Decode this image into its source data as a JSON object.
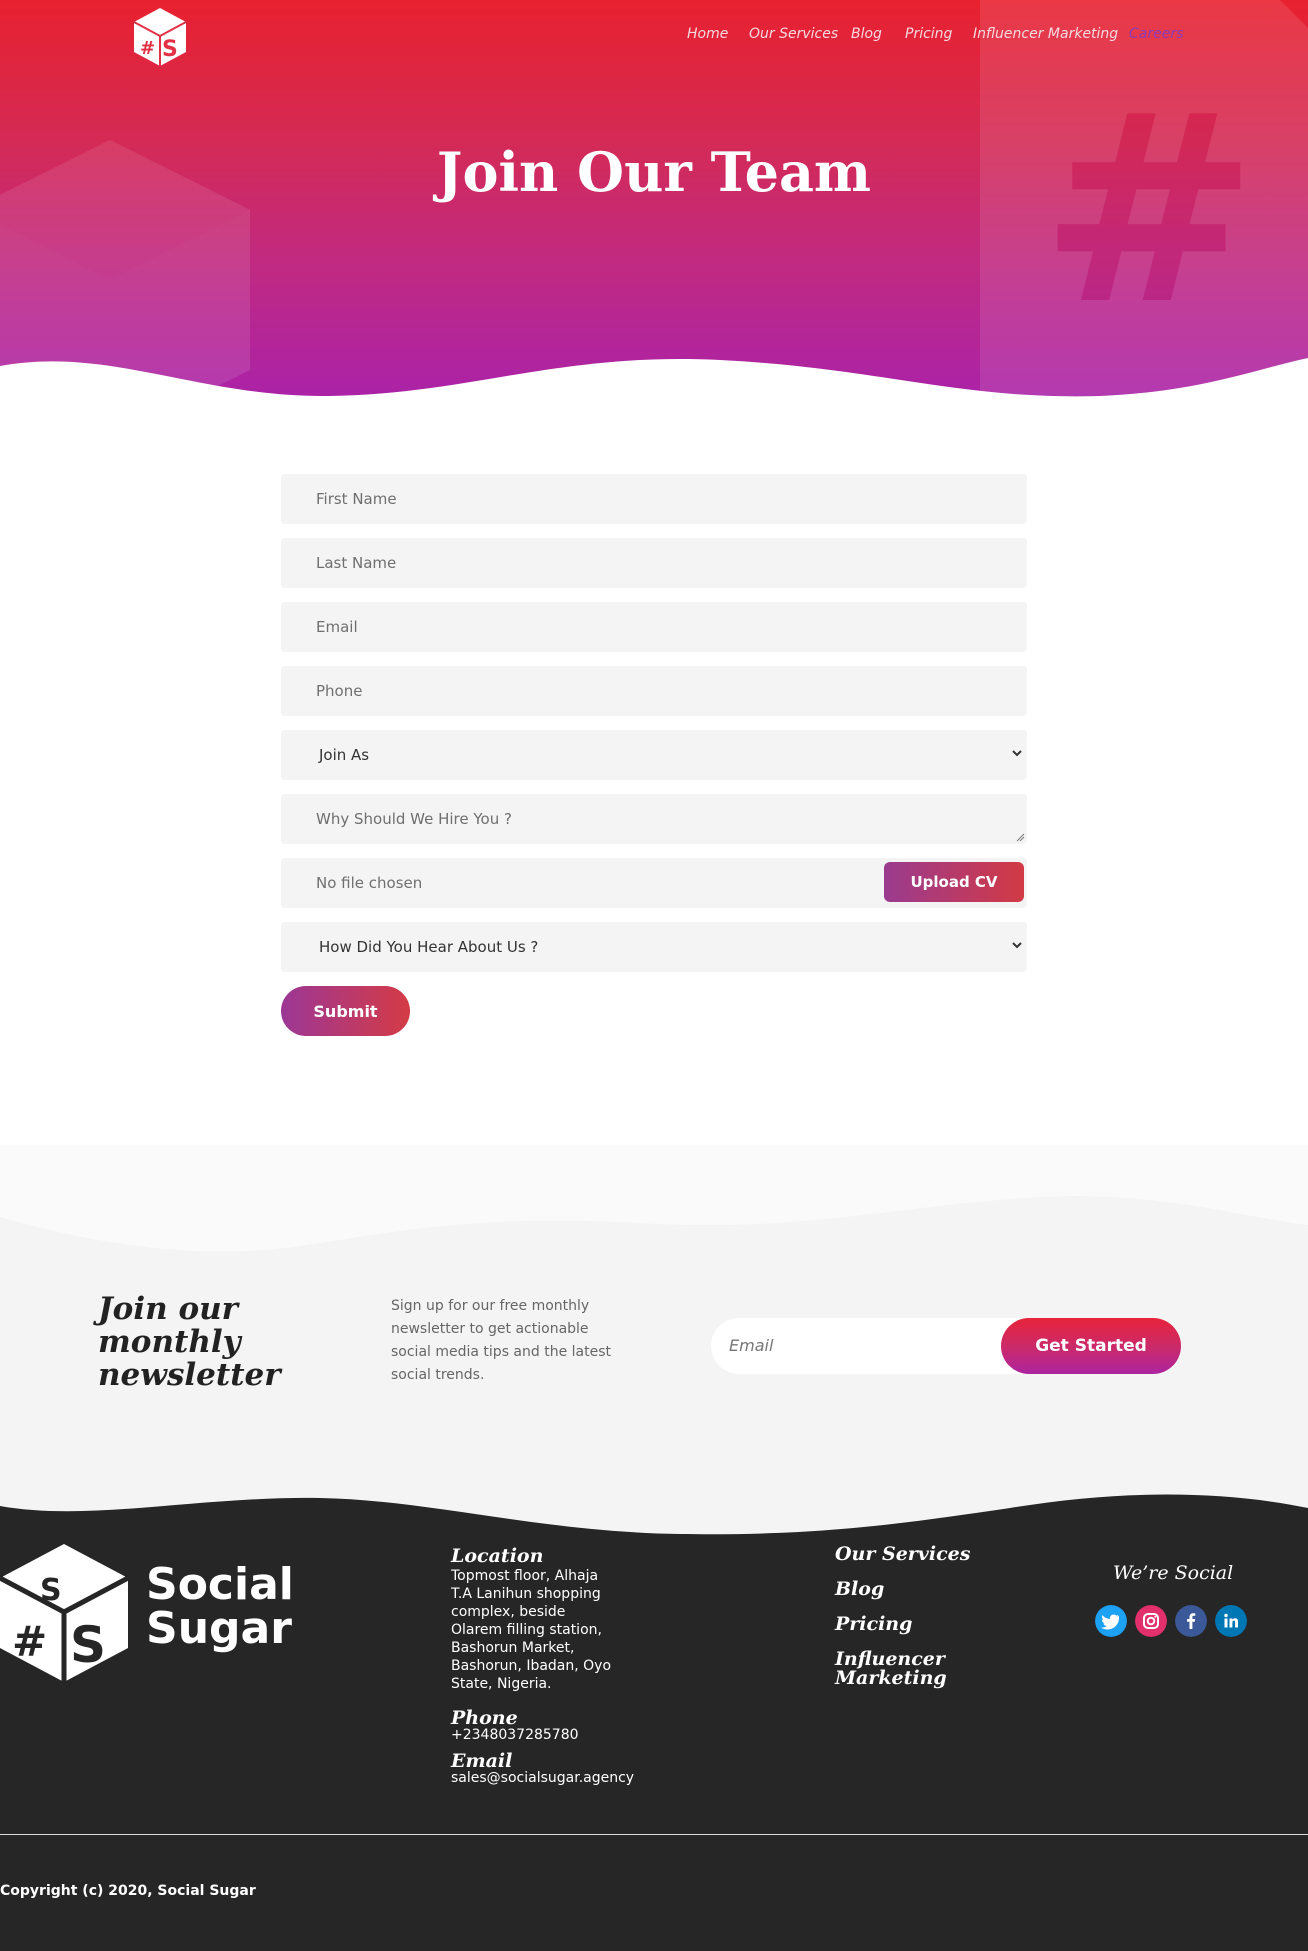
{
  "brand": {
    "name": "Social Sugar",
    "logo_glyph": "#S",
    "accent_colors": [
      "#e8212f",
      "#aa22a8"
    ]
  },
  "nav": {
    "items": [
      {
        "label": "Home"
      },
      {
        "label": "Our Services"
      },
      {
        "label": "Blog"
      },
      {
        "label": "Pricing"
      },
      {
        "label": "Influencer Marketing"
      },
      {
        "label": "Careers",
        "active": true
      }
    ]
  },
  "hero": {
    "title": "Join Our Team"
  },
  "form": {
    "first_name_placeholder": "First Name",
    "last_name_placeholder": "Last Name",
    "email_placeholder": "Email",
    "phone_placeholder": "Phone",
    "join_as_selected": "Join As",
    "why_hire_placeholder": "Why Should We Hire You ?",
    "file_status": "No file chosen",
    "upload_label": "Upload CV",
    "hear_about_selected": "How Did You Hear About Us ?",
    "submit_label": "Submit"
  },
  "newsletter": {
    "title": "Join our monthly newsletter",
    "text": "Sign up for our free monthly newsletter to get actionable social media tips and the latest social trends.",
    "email_placeholder": "Email",
    "button_label": "Get Started"
  },
  "footer": {
    "logo_line1": "Social",
    "logo_line2": "Sugar",
    "location_heading": "Location",
    "location_lines": [
      "Topmost floor, Alhaja",
      "T.A Lanihun shopping",
      "complex, beside",
      "Olarem filling station,",
      "Bashorun Market,",
      "Bashorun, Ibadan, Oyo",
      "State, Nigeria."
    ],
    "phone_heading": "Phone",
    "phone": "+2348037285780",
    "email_heading": "Email",
    "email": "sales@socialsugar.agency",
    "links": [
      "Our Services",
      "Blog",
      "Pricing",
      "Influencer",
      "Marketing"
    ],
    "social_heading": "We’re Social",
    "social_icons": [
      {
        "name": "twitter-icon",
        "color": "#1da1f2"
      },
      {
        "name": "instagram-icon",
        "color": "#e1306c"
      },
      {
        "name": "facebook-icon",
        "color": "#3b5998"
      },
      {
        "name": "linkedin-icon",
        "color": "#0077b5"
      }
    ],
    "copyright": "Copyright (c) 2020, Social Sugar"
  }
}
